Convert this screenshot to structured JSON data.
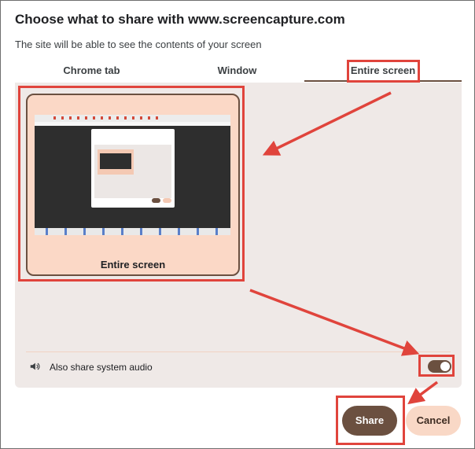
{
  "dialog": {
    "title": "Choose what to share with www.screencapture.com",
    "subtitle": "The site will be able to see the contents of your screen"
  },
  "tabs": [
    {
      "label": "Chrome tab",
      "selected": false
    },
    {
      "label": "Window",
      "selected": false
    },
    {
      "label": "Entire screen",
      "selected": true
    }
  ],
  "screen_card": {
    "label": "Entire screen",
    "selected": true
  },
  "audio": {
    "label": "Also share system audio",
    "enabled": true,
    "icon": "speaker-icon"
  },
  "buttons": {
    "share_label": "Share",
    "cancel_label": "Cancel"
  },
  "colors": {
    "accent": "#6b5040",
    "card_bg": "#fbd8c6",
    "panel_bg": "#efe9e7",
    "annotation": "#e0443c"
  }
}
